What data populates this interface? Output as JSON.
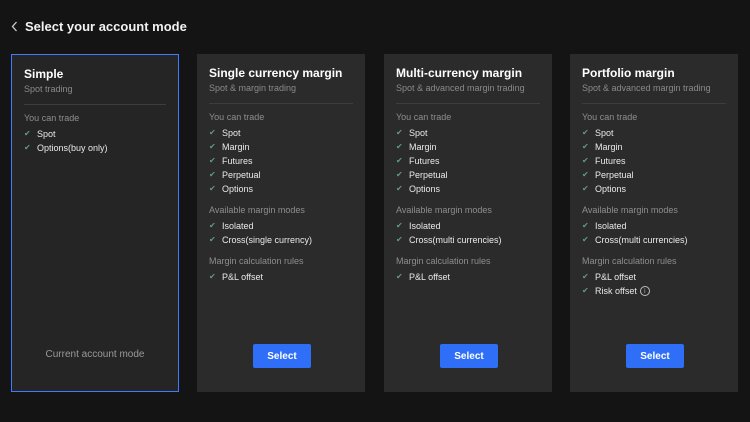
{
  "header": {
    "title": "Select your account mode",
    "back_icon": "chevron-left-icon"
  },
  "colors": {
    "background": "#141414",
    "card": "#2b2b2b",
    "selected_border": "#3d7bff",
    "button": "#2f6ff7",
    "check": "#5f9c80"
  },
  "cards": [
    {
      "title": "Simple",
      "subtitle": "Spot trading",
      "selected": true,
      "current_label": "Current account mode",
      "trade_label": "You can trade",
      "trade_items": [
        "Spot",
        "Options(buy only)"
      ]
    },
    {
      "title": "Single currency margin",
      "subtitle": "Spot & margin trading",
      "trade_label": "You can trade",
      "trade_items": [
        "Spot",
        "Margin",
        "Futures",
        "Perpetual",
        "Options"
      ],
      "margin_label": "Available margin modes",
      "margin_items": [
        "Isolated",
        "Cross(single currency)"
      ],
      "rules_label": "Margin calculation rules",
      "rules_items": [
        "P&L offset"
      ],
      "button_label": "Select"
    },
    {
      "title": "Multi-currency margin",
      "subtitle": "Spot & advanced margin trading",
      "trade_label": "You can trade",
      "trade_items": [
        "Spot",
        "Margin",
        "Futures",
        "Perpetual",
        "Options"
      ],
      "margin_label": "Available margin modes",
      "margin_items": [
        "Isolated",
        "Cross(multi currencies)"
      ],
      "rules_label": "Margin calculation rules",
      "rules_items": [
        "P&L offset"
      ],
      "button_label": "Select"
    },
    {
      "title": "Portfolio margin",
      "subtitle": "Spot & advanced margin trading",
      "trade_label": "You can trade",
      "trade_items": [
        "Spot",
        "Margin",
        "Futures",
        "Perpetual",
        "Options"
      ],
      "margin_label": "Available margin modes",
      "margin_items": [
        "Isolated",
        "Cross(multi currencies)"
      ],
      "rules_label": "Margin calculation rules",
      "rules_items": [
        "P&L offset",
        "Risk offset"
      ],
      "button_label": "Select"
    }
  ]
}
